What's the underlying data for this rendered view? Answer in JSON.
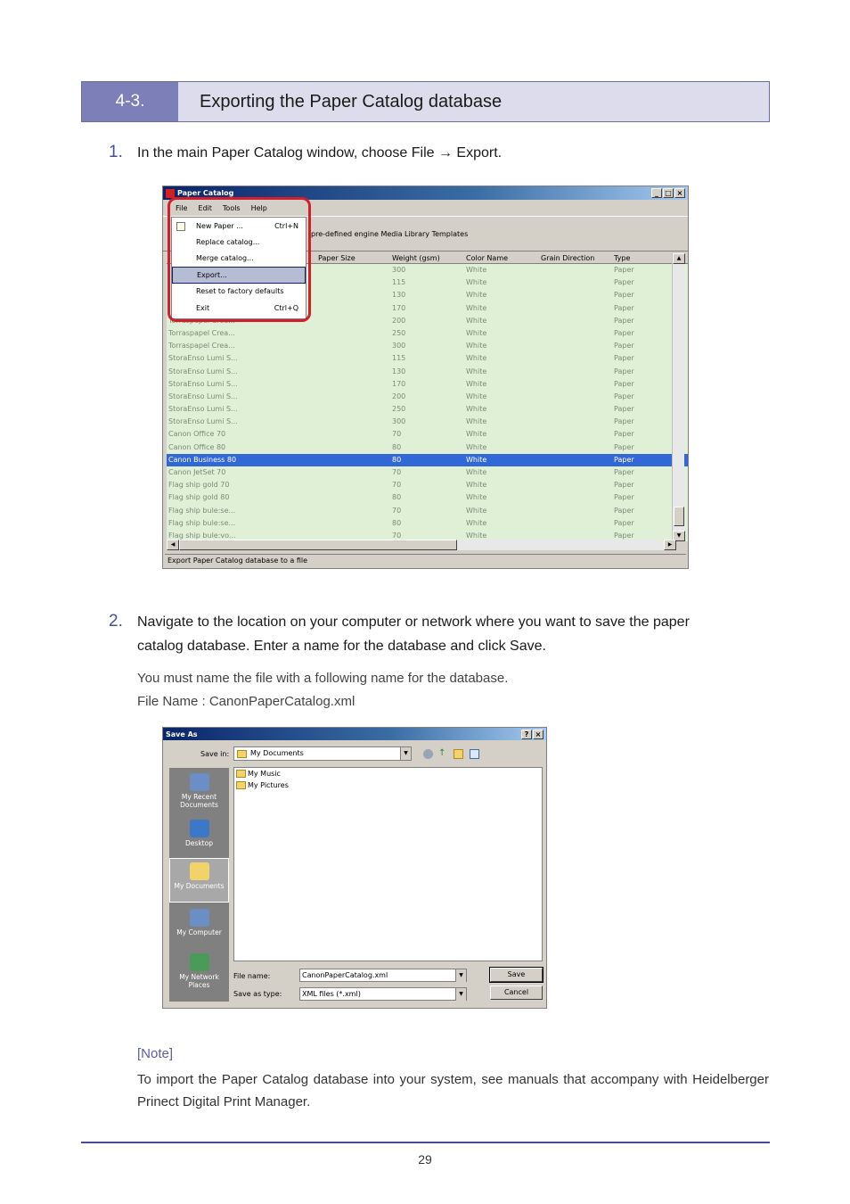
{
  "section": {
    "number": "4-3.",
    "title": "Exporting the Paper Catalog database"
  },
  "step1": {
    "number": "1.",
    "text": "In the main Paper Catalog window, choose File → Export."
  },
  "step2": {
    "number": "2.",
    "line1": "Navigate to the location on your computer or network where you want to save the paper",
    "line2": "catalog database.  Enter a name for the database and click Save.",
    "info1": "You must name the file with a following name for the database.",
    "info2": "File Name : CanonPaperCatalog.xml"
  },
  "catalog_window": {
    "title": "Paper Catalog",
    "menus": [
      "File",
      "Edit",
      "Tools",
      "Help"
    ],
    "template_label": "pre-defined engine Media Library Templates",
    "columns": [
      "Paper Size",
      "Weight (gsm)",
      "Color Name",
      "Grain Direction",
      "Type"
    ],
    "rows": [
      {
        "name": "",
        "weight": "300",
        "color": "White",
        "type": "Paper"
      },
      {
        "name": "",
        "weight": "115",
        "color": "White",
        "type": "Paper"
      },
      {
        "name": "",
        "weight": "130",
        "color": "White",
        "type": "Paper"
      },
      {
        "name": "",
        "weight": "170",
        "color": "White",
        "type": "Paper"
      },
      {
        "name": "Torraspapel Crea...",
        "weight": "200",
        "color": "White",
        "type": "Paper"
      },
      {
        "name": "Torraspapel Crea...",
        "weight": "250",
        "color": "White",
        "type": "Paper"
      },
      {
        "name": "Torraspapel Crea...",
        "weight": "300",
        "color": "White",
        "type": "Paper"
      },
      {
        "name": "StoraEnso Lumi S...",
        "weight": "115",
        "color": "White",
        "type": "Paper"
      },
      {
        "name": "StoraEnso Lumi S...",
        "weight": "130",
        "color": "White",
        "type": "Paper"
      },
      {
        "name": "StoraEnso Lumi S...",
        "weight": "170",
        "color": "White",
        "type": "Paper"
      },
      {
        "name": "StoraEnso Lumi S...",
        "weight": "200",
        "color": "White",
        "type": "Paper"
      },
      {
        "name": "StoraEnso Lumi S...",
        "weight": "250",
        "color": "White",
        "type": "Paper"
      },
      {
        "name": "StoraEnso Lumi S...",
        "weight": "300",
        "color": "White",
        "type": "Paper"
      },
      {
        "name": "Canon Office 70",
        "weight": "70",
        "color": "White",
        "type": "Paper"
      },
      {
        "name": "Canon Office 80",
        "weight": "80",
        "color": "White",
        "type": "Paper"
      },
      {
        "name": "Canon Business 80",
        "weight": "80",
        "color": "White",
        "type": "Paper"
      },
      {
        "name": "Canon JetSet 70",
        "weight": "70",
        "color": "White",
        "type": "Paper"
      },
      {
        "name": "Flag ship gold 70",
        "weight": "70",
        "color": "White",
        "type": "Paper"
      },
      {
        "name": "Flag ship gold 80",
        "weight": "80",
        "color": "White",
        "type": "Paper"
      },
      {
        "name": "Flag ship bule:se...",
        "weight": "70",
        "color": "White",
        "type": "Paper"
      },
      {
        "name": "Flag ship bule:se...",
        "weight": "80",
        "color": "White",
        "type": "Paper"
      },
      {
        "name": "Flag ship bule:vo...",
        "weight": "70",
        "color": "White",
        "type": "Paper"
      }
    ],
    "selected_row": "Canon Business 80",
    "status": "Export Paper Catalog database to a file"
  },
  "file_menu": {
    "items": [
      {
        "label": "New Paper ...",
        "shortcut": "Ctrl+N"
      },
      {
        "label": "Replace catalog...",
        "shortcut": ""
      },
      {
        "label": "Merge catalog...",
        "shortcut": ""
      },
      {
        "label": "Export...",
        "shortcut": ""
      },
      {
        "label": "Reset to factory defaults",
        "shortcut": ""
      },
      {
        "label": "Exit",
        "shortcut": "Ctrl+Q"
      }
    ],
    "highlighted": "Export..."
  },
  "save_dialog": {
    "title": "Save As",
    "save_in_label": "Save in:",
    "save_in_value": "My Documents",
    "places": [
      "My Recent Documents",
      "Desktop",
      "My Documents",
      "My Computer",
      "My Network Places"
    ],
    "active_place": "My Documents",
    "files": [
      "My Music",
      "My Pictures"
    ],
    "file_name_label": "File name:",
    "file_name_value": "CanonPaperCatalog.xml",
    "save_type_label": "Save as type:",
    "save_type_value": "XML files (*.xml)",
    "save_button": "Save",
    "cancel_button": "Cancel"
  },
  "note": {
    "label": "[Note]",
    "text": "To import the Paper Catalog database into your system, see manuals that accompany with Heidelberger Prinect Digital Print Manager."
  },
  "page_number": "29",
  "colors": {
    "accent": "#4a4c9a",
    "header_band": "#dcdcec",
    "number_band": "#7d7fb8",
    "highlight_ring": "#d21f2b",
    "grid_bg": "#dff0d6",
    "selection": "#3168d6"
  }
}
